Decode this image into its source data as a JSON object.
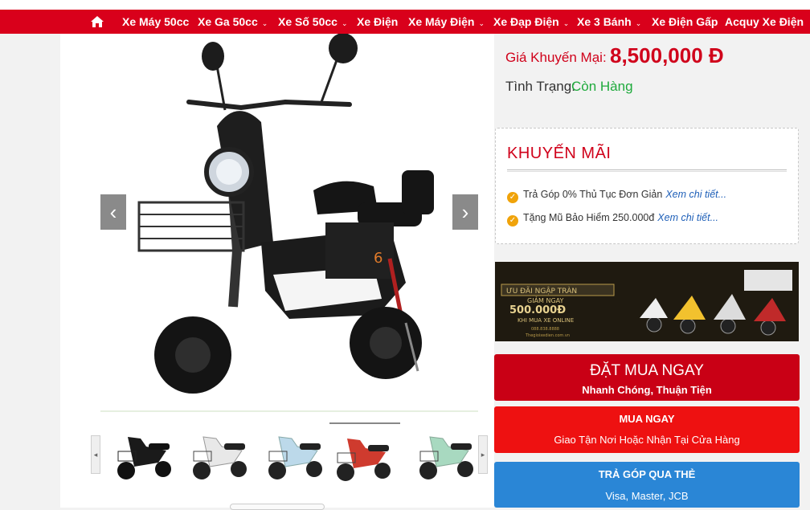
{
  "nav": {
    "home_icon": "home-icon",
    "items": [
      {
        "label": "Xe Máy 50cc",
        "dropdown": false
      },
      {
        "label": "Xe Ga 50cc",
        "dropdown": true
      },
      {
        "label": "Xe Số 50cc",
        "dropdown": true
      },
      {
        "label": "Xe Điện",
        "dropdown": false
      },
      {
        "label": "Xe Máy Điện",
        "dropdown": true
      },
      {
        "label": "Xe Đạp Điện",
        "dropdown": true
      },
      {
        "label": "Xe 3 Bánh",
        "dropdown": true
      },
      {
        "label": "Xe Điện Gấp",
        "dropdown": false
      },
      {
        "label": "Acquy Xe Điện",
        "dropdown": false
      }
    ]
  },
  "gallery": {
    "prev": "‹",
    "next": "›",
    "thumb_prev": "◂",
    "thumb_next": "▸",
    "thumb_colors": [
      "#1a1a1a",
      "#e8e8e8",
      "#bcd9ea",
      "#cf3b2e",
      "#a8d9c0"
    ],
    "active_thumb": 4
  },
  "price": {
    "label": "Giá Khuyến Mại:",
    "value": "8,500,000 Đ",
    "status_label": "Tình Trạng:",
    "status_value": "Còn Hàng"
  },
  "promo": {
    "title": "KHUYẾN MÃI",
    "items": [
      {
        "text": "Trả Góp 0% Thủ Tục Đơn Giản",
        "more": "Xem chi tiết..."
      },
      {
        "text": "Tặng Mũ Bảo Hiểm 250.000đ",
        "more": "Xem chi tiết..."
      }
    ]
  },
  "banner": {
    "line1": "ƯU ĐÃI NGẬP TRÀN",
    "line2": "GIẢM NGAY",
    "amount": "500.000Đ",
    "line3": "KHI MUA XE ONLINE",
    "phone": "088.838.8888",
    "site": "Thegioixedien.com.vn"
  },
  "cta": {
    "order_now": "ĐẶT MUA NGAY",
    "order_sub": "Nhanh Chóng, Thuận Tiện",
    "buy_now": "MUA NGAY",
    "buy_sub": "Giao Tận Nơi Hoặc Nhận Tại Cửa Hàng",
    "installment": "TRẢ GÓP QUA THẺ",
    "installment_sub": "Visa, Master, JCB"
  }
}
